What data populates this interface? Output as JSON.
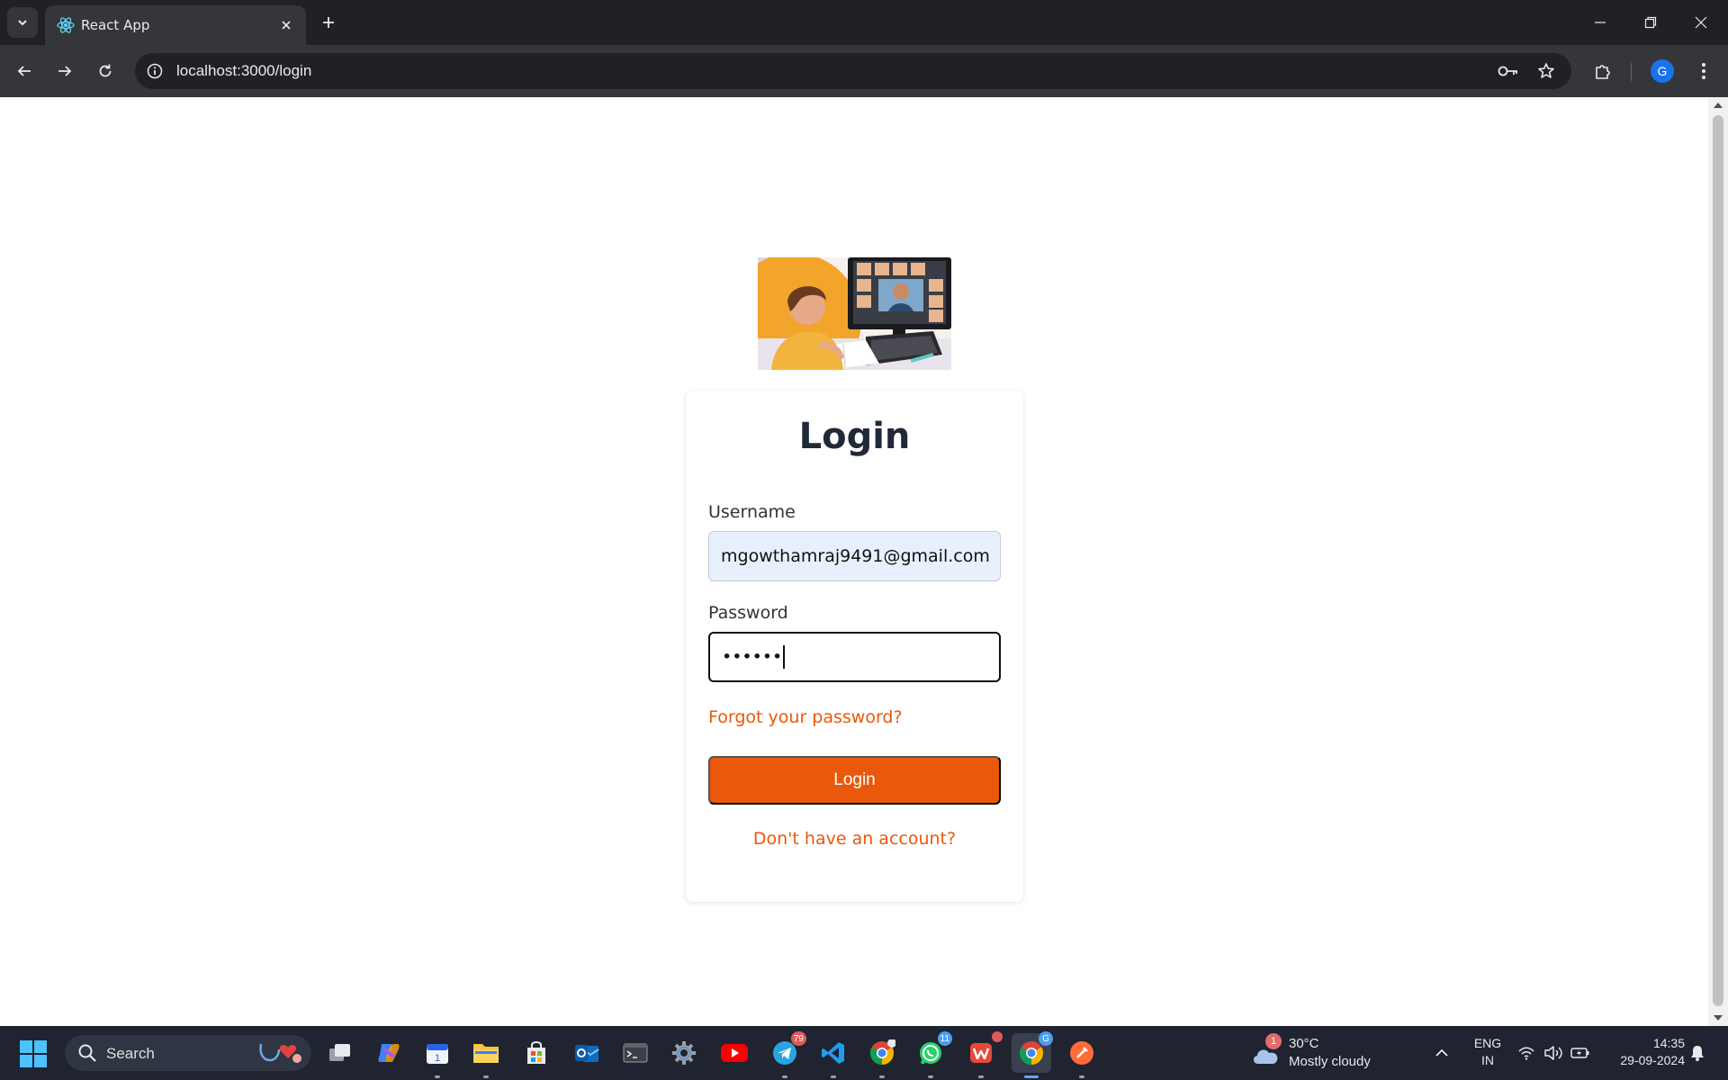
{
  "browser": {
    "tab_title": "React App",
    "url": "localhost:3000/login",
    "profile_initial": "G"
  },
  "page": {
    "title": "Login",
    "username_label": "Username",
    "username_value": "mgowthamraj9491@gmail.com",
    "password_label": "Password",
    "password_value": "••••••",
    "forgot_link": "Forgot your password?",
    "login_button": "Login",
    "signup_link": "Don't have an account?",
    "accent_color": "#ea580c"
  },
  "taskbar": {
    "search_label": "Search",
    "apps": [
      {
        "name": "task-view"
      },
      {
        "name": "copilot"
      },
      {
        "name": "calendar"
      },
      {
        "name": "file-explorer"
      },
      {
        "name": "microsoft-store"
      },
      {
        "name": "outlook"
      },
      {
        "name": "terminal"
      },
      {
        "name": "settings"
      },
      {
        "name": "youtube"
      },
      {
        "name": "telegram",
        "badge": "79"
      },
      {
        "name": "vs-code"
      },
      {
        "name": "chrome"
      },
      {
        "name": "whatsapp",
        "badge": "11"
      },
      {
        "name": "wps-office"
      },
      {
        "name": "chrome-profile",
        "badge": "G"
      },
      {
        "name": "postman"
      }
    ],
    "weather": {
      "temp": "30°C",
      "condition": "Mostly cloudy",
      "badge": "1"
    },
    "language": {
      "line1": "ENG",
      "line2": "IN"
    },
    "clock": {
      "time": "14:35",
      "date": "29-09-2024"
    }
  }
}
